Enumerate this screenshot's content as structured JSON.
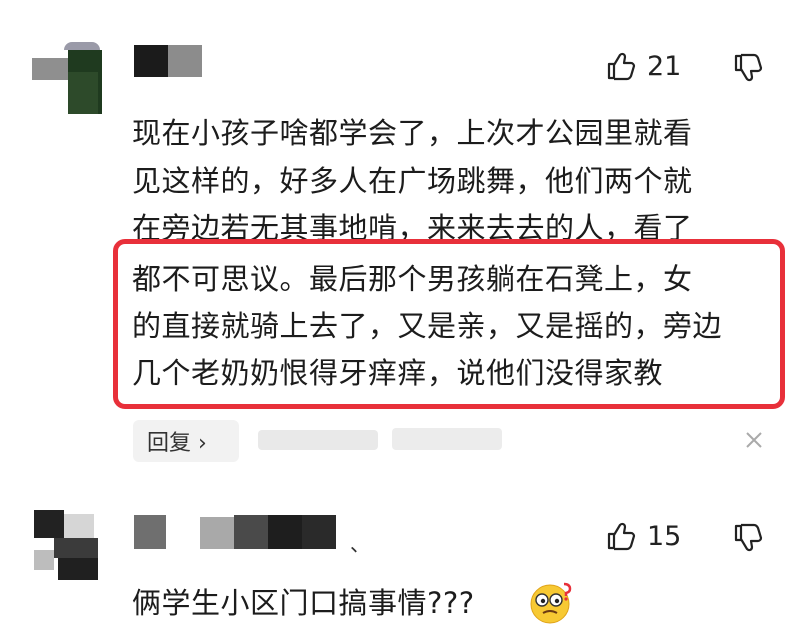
{
  "comments": [
    {
      "likes": "21",
      "lines": [
        "现在小孩子啥都学会了，上次才公园里就看",
        "见这样的，好多人在广场跳舞，他们两个就",
        "在旁边若无其事地啃，来来去去的人，看了"
      ],
      "highlighted_lines": [
        "都不可思议。最后那个男孩躺在石凳上，女",
        "的直接就骑上去了，又是亲，又是摇的，旁边",
        "几个老奶奶恨得牙痒痒，说他们没得家教"
      ],
      "reply_label": "回复 ›"
    },
    {
      "likes": "15",
      "name_suffix": "、",
      "text": "俩学生小区门口搞事情???"
    }
  ],
  "colors": {
    "highlight": "#e8303a",
    "text": "#1c1c1c"
  },
  "icons": [
    "thumb-up-icon",
    "thumb-down-icon",
    "close-icon",
    "thinking-emoji-icon"
  ]
}
